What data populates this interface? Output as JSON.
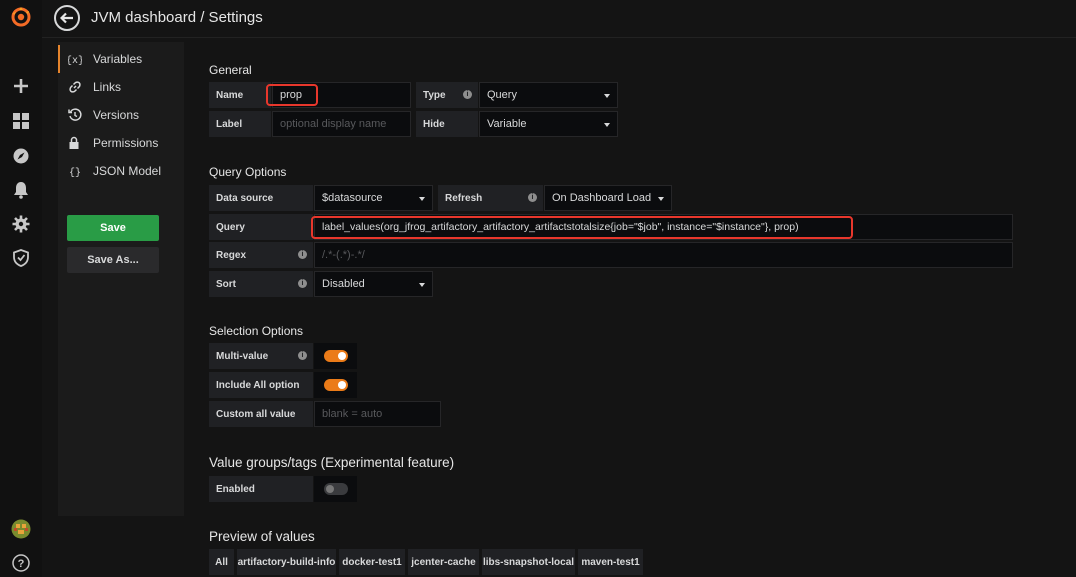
{
  "page_title": "JVM dashboard / Settings",
  "nav_icons": [
    "grafana-logo",
    "plus-icon",
    "dashboards-icon",
    "explore-icon",
    "bell-icon",
    "gear-icon",
    "shield-icon",
    "avatar",
    "help-icon"
  ],
  "settings_menu": {
    "items": [
      {
        "label": "Variables",
        "icon": "variables-icon"
      },
      {
        "label": "Links",
        "icon": "link-icon"
      },
      {
        "label": "Versions",
        "icon": "history-icon"
      },
      {
        "label": "Permissions",
        "icon": "lock-icon"
      },
      {
        "label": "JSON Model",
        "icon": "json-icon"
      }
    ],
    "active": "Variables",
    "save_label": "Save",
    "save_as_label": "Save As..."
  },
  "general": {
    "title": "General",
    "name_label": "Name",
    "name_value": "prop",
    "type_label": "Type",
    "type_value": "Query",
    "label_label": "Label",
    "label_placeholder": "optional display name",
    "hide_label": "Hide",
    "hide_value": "Variable"
  },
  "query_options": {
    "title": "Query Options",
    "datasource_label": "Data source",
    "datasource_value": "$datasource",
    "refresh_label": "Refresh",
    "refresh_value": "On Dashboard Load",
    "query_label": "Query",
    "query_value": "label_values(org_jfrog_artifactory_artifactory_artifactstotalsize{job=\"$job\", instance=\"$instance\"}, prop)",
    "regex_label": "Regex",
    "regex_placeholder": "/.*-(.*)-.*/",
    "sort_label": "Sort",
    "sort_value": "Disabled"
  },
  "selection_options": {
    "title": "Selection Options",
    "multi_value_label": "Multi-value",
    "multi_value": true,
    "include_all_label": "Include All option",
    "include_all": true,
    "custom_all_label": "Custom all value",
    "custom_all_placeholder": "blank = auto"
  },
  "value_groups": {
    "title": "Value groups/tags (Experimental feature)",
    "enabled_label": "Enabled",
    "enabled": false
  },
  "preview": {
    "title": "Preview of values",
    "values": [
      "All",
      "artifactory-build-info",
      "docker-test1",
      "jcenter-cache",
      "libs-snapshot-local",
      "maven-test1"
    ]
  },
  "colors": {
    "accent_orange": "#eb7b18",
    "save_green": "#299c46",
    "highlight_red": "#e8372c"
  }
}
